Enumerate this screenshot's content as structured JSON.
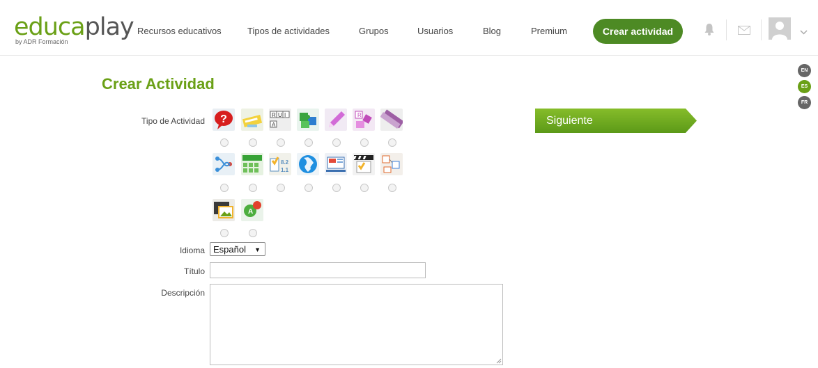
{
  "logo": {
    "text_green": "educa",
    "text_gray": "play",
    "subtitle": "by ADR Formación"
  },
  "nav": [
    {
      "label": "Recursos educativos"
    },
    {
      "label": "Tipos de actividades"
    },
    {
      "label": "Grupos"
    },
    {
      "label": "Usuarios"
    },
    {
      "label": "Blog"
    },
    {
      "label": "Premium"
    }
  ],
  "cta": {
    "label": "Crear actividad"
  },
  "header_icons": [
    "bell-icon",
    "mail-icon",
    "avatar-icon",
    "chevron-down-icon"
  ],
  "languages": [
    {
      "code": "EN",
      "active": false
    },
    {
      "code": "ES",
      "active": true
    },
    {
      "code": "FR",
      "active": false
    }
  ],
  "page": {
    "title": "Crear Actividad"
  },
  "form": {
    "tipo_label": "Tipo de Actividad",
    "activity_types": [
      {
        "icon": "question-icon"
      },
      {
        "icon": "fill-blanks-icon"
      },
      {
        "icon": "crossword-icon"
      },
      {
        "icon": "puzzle-icon"
      },
      {
        "icon": "pencil-icon"
      },
      {
        "icon": "alphabet-icon"
      },
      {
        "icon": "word-search-icon"
      },
      {
        "icon": "relations-icon"
      },
      {
        "icon": "wordsearch-grid-icon"
      },
      {
        "icon": "test-icon"
      },
      {
        "icon": "map-icon"
      },
      {
        "icon": "presentation-icon"
      },
      {
        "icon": "video-quiz-icon"
      },
      {
        "icon": "sort-icon"
      },
      {
        "icon": "image-icon"
      },
      {
        "icon": "dialog-icon"
      }
    ],
    "idioma_label": "Idioma",
    "idioma_value": "Español",
    "titulo_label": "Título",
    "titulo_value": "",
    "descripcion_label": "Descripción",
    "descripcion_value": ""
  },
  "next_button": {
    "label": "Siguiente"
  },
  "colors": {
    "brand_green": "#6aa016",
    "cta_green": "#4d8a24",
    "lang_gray": "#666666"
  }
}
